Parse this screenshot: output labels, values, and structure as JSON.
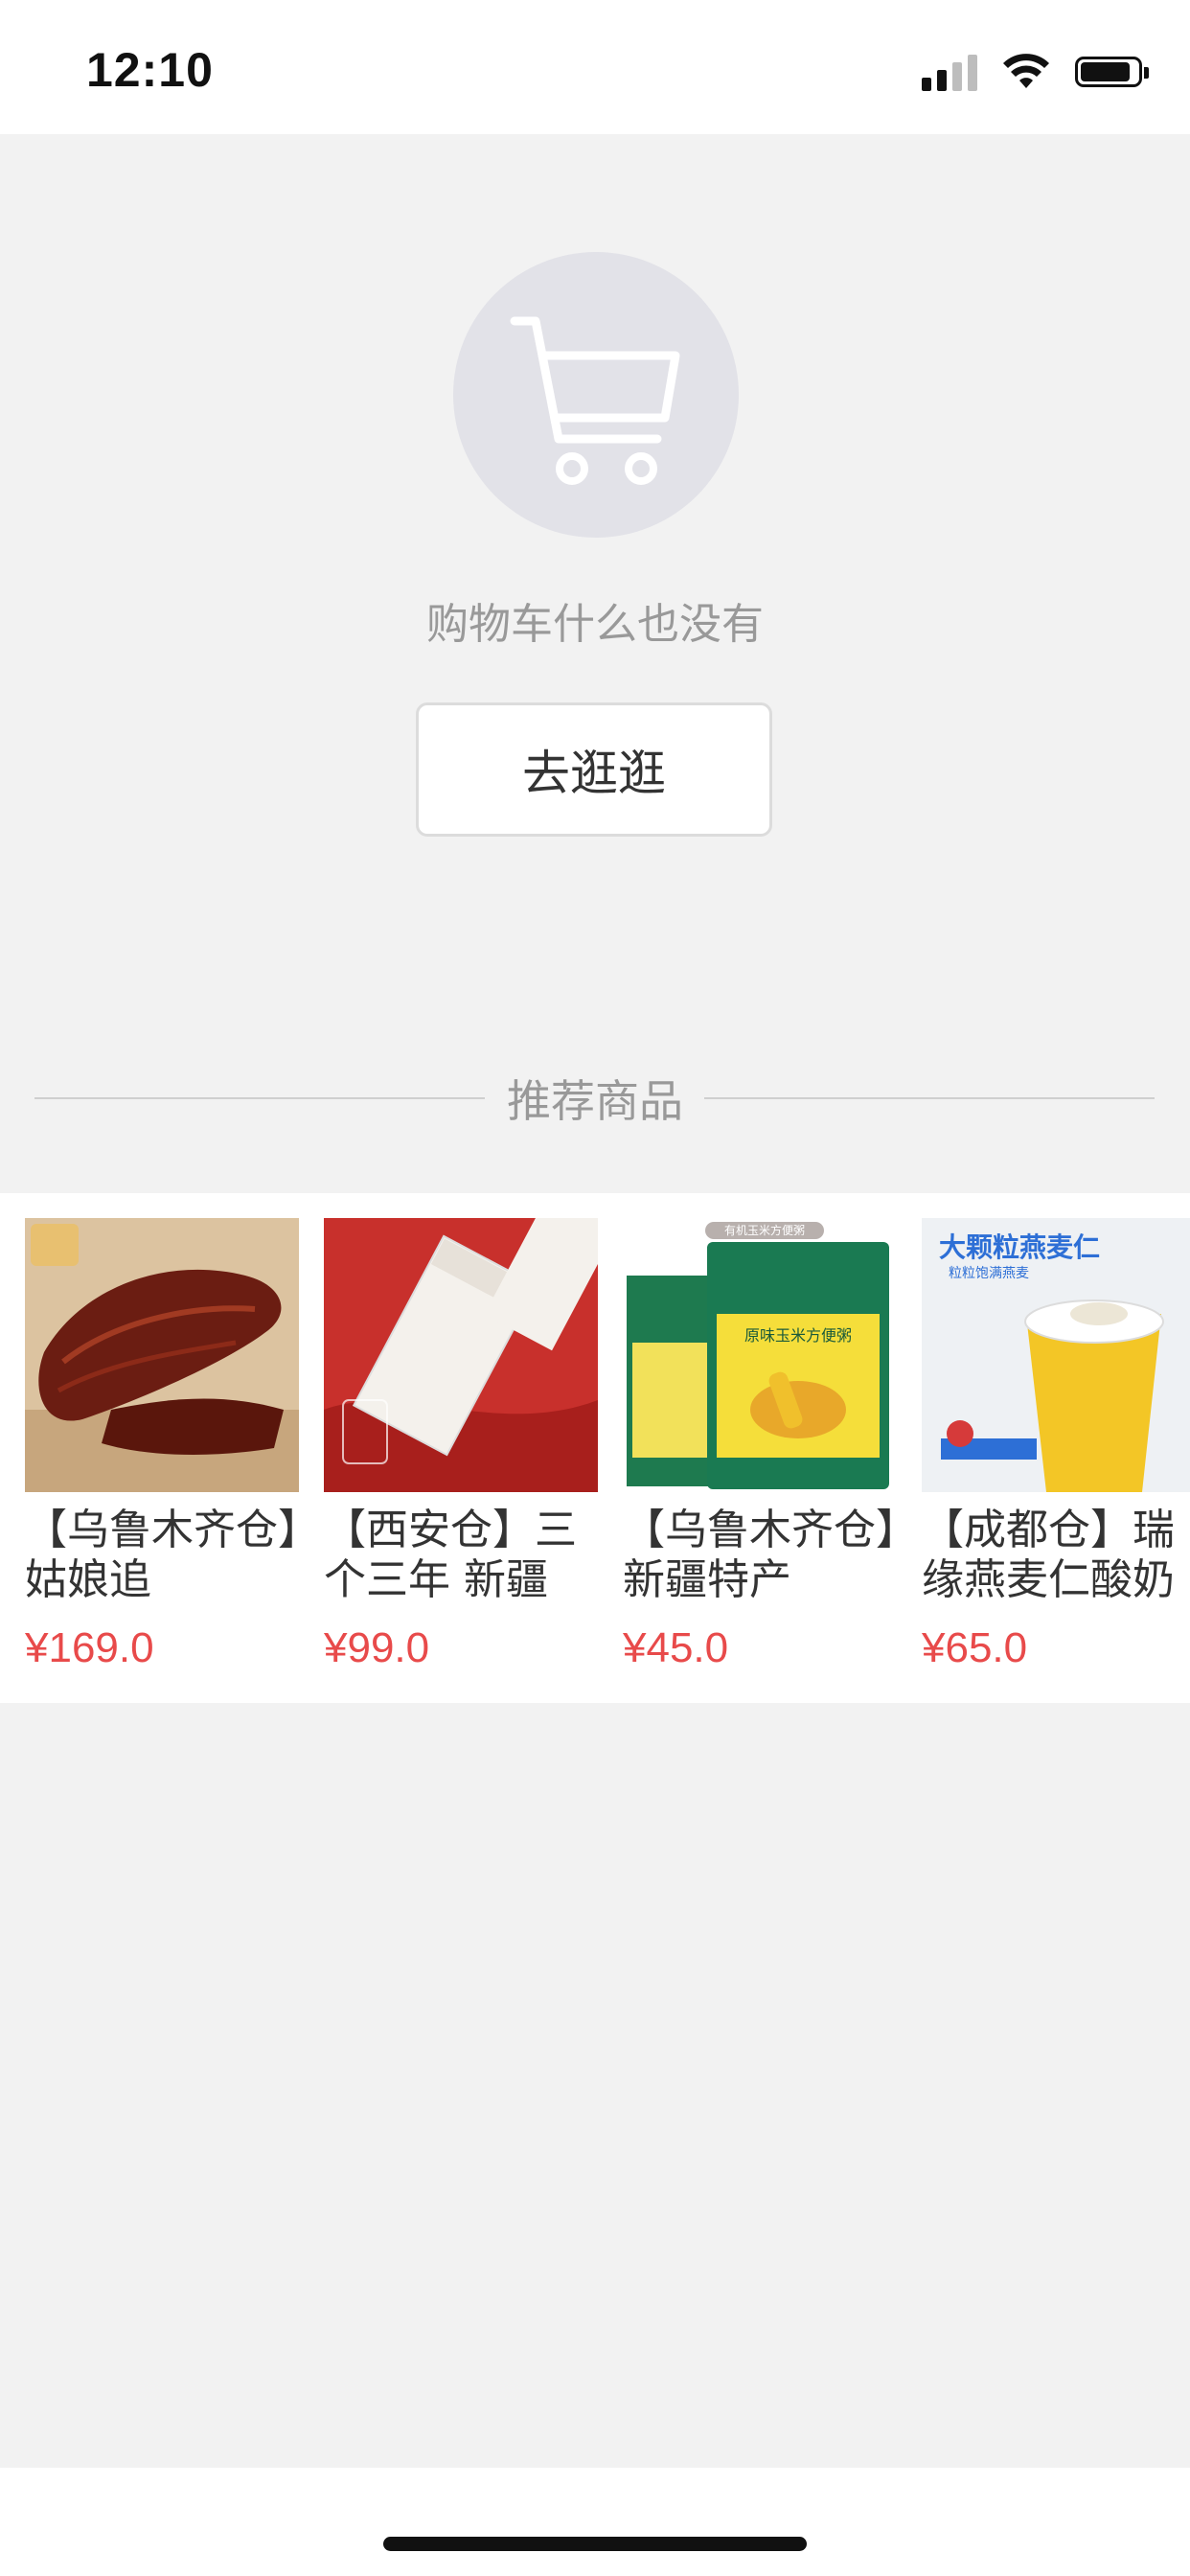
{
  "status_bar": {
    "time": "12:10"
  },
  "empty_cart": {
    "message": "购物车什么也没有",
    "button_label": "去逛逛"
  },
  "recommend": {
    "title": "推荐商品",
    "products": [
      {
        "name": "【乌鲁木齐仓】姑娘追",
        "price": "¥169.0",
        "image": "dried-beef-jerky"
      },
      {
        "name": "【西安仓】三个三年 新疆",
        "price": "¥99.0",
        "image": "xinjiang-milk-box"
      },
      {
        "name": "【乌鲁木齐仓】新疆特产",
        "price": "¥45.0",
        "image": "corn-porridge-bag",
        "image_badge": "有机玉米方便粥",
        "image_text": "原味玉米方便粥"
      },
      {
        "name": "【成都仓】瑞缘燕麦仁酸奶",
        "price": "¥65.0",
        "image": "oat-yogurt-cup",
        "image_text": "大颗粒燕麦仁",
        "image_subtext": "粒粒饱满燕麦"
      }
    ]
  },
  "colors": {
    "price": "#e84a4a",
    "background": "#f2f2f2"
  }
}
